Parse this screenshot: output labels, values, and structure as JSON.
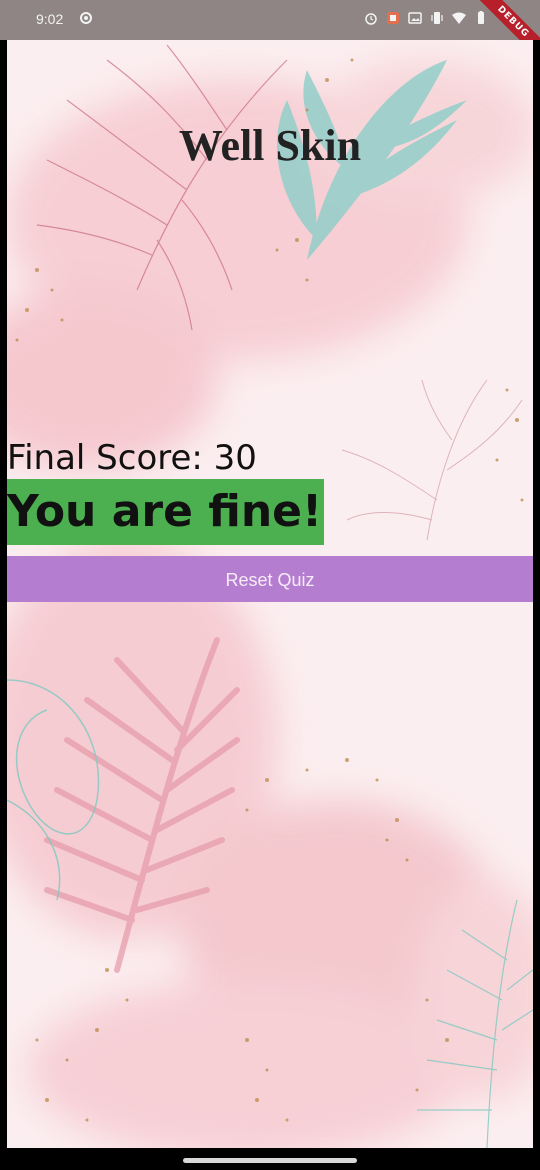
{
  "status_bar": {
    "time": "9:02",
    "icons": [
      "radio-icon",
      "alarm-icon",
      "notification-icon",
      "gallery-icon",
      "vibrate-icon",
      "wifi-icon",
      "battery-icon"
    ],
    "debug_label": "DEBUG"
  },
  "app": {
    "title": "Well Skin",
    "final_score_label": "Final Score: 30",
    "result_message": "You are fine!",
    "reset_button_label": "Reset Quiz"
  },
  "colors": {
    "background": "#fbeef0",
    "result_highlight": "#4caf50",
    "reset_button": "#b57dd0",
    "status_bar": "#8f8585"
  }
}
